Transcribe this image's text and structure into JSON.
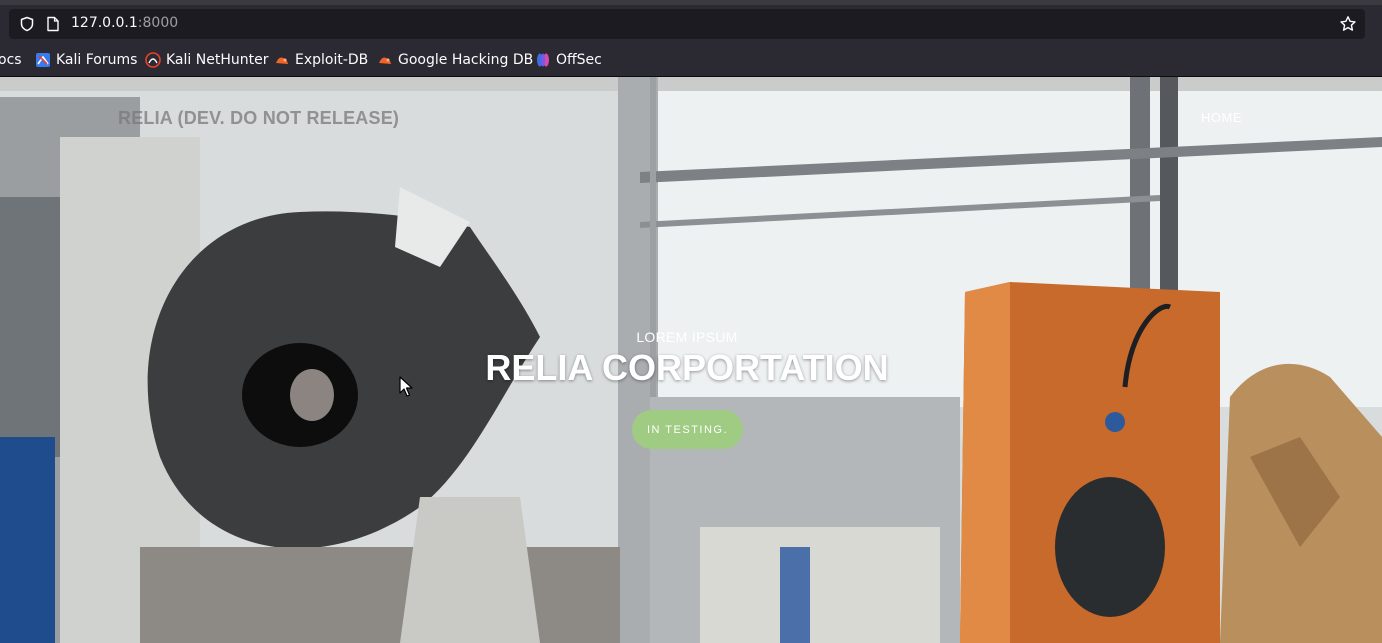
{
  "browser": {
    "url_host": "127.0.0.1",
    "url_port": ":8000",
    "icons": [
      "shield-icon",
      "page-icon",
      "star-icon"
    ]
  },
  "bookmarks": [
    {
      "label": "ocs",
      "icon": "docs-icon"
    },
    {
      "label": "Kali Forums",
      "icon": "kali-forums-icon"
    },
    {
      "label": "Kali NetHunter",
      "icon": "kali-nethunter-icon"
    },
    {
      "label": "Exploit-DB",
      "icon": "exploit-db-icon"
    },
    {
      "label": "Google Hacking DB",
      "icon": "ghdb-icon"
    },
    {
      "label": "OffSec",
      "icon": "offsec-icon"
    }
  ],
  "site": {
    "brand": "RELIA (DEV. DO NOT RELEASE)",
    "nav_home": "HOME",
    "hero_subheading": "LOREM IPSUM",
    "hero_heading": "RELIA CORPORTATION",
    "hero_button": "IN TESTING.",
    "button_color": "#9fcc82"
  }
}
